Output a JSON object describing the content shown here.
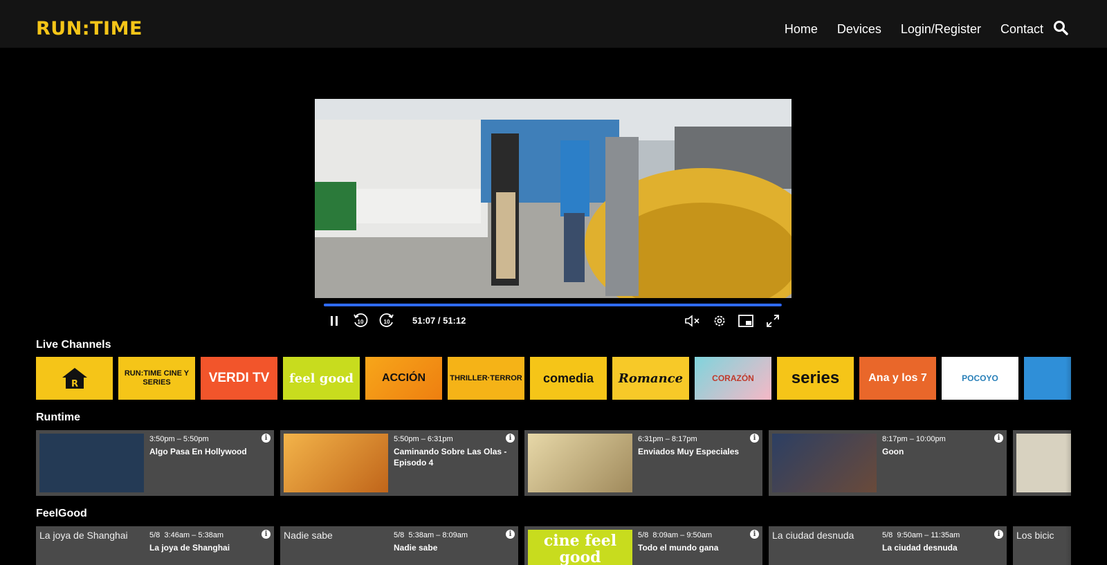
{
  "header": {
    "logo": "RUN:TIME",
    "nav": [
      "Home",
      "Devices",
      "Login/Register",
      "Contact"
    ],
    "search_icon": "search-icon"
  },
  "player": {
    "time": "51:07 / 51:12",
    "progress": 0.998,
    "controls": [
      "pause-icon",
      "rewind-10-icon",
      "forward-10-icon",
      "mute-icon",
      "settings-icon",
      "pip-icon",
      "fullscreen-icon"
    ]
  },
  "live_channels": {
    "title": "Live Channels",
    "items": [
      {
        "name": "home",
        "label": "R",
        "bg": "#f5c518",
        "fg": "#111"
      },
      {
        "name": "runtime-cine-series",
        "label": "RUN:TIME CINE Y SERIES",
        "bg": "#f5c518",
        "fg": "#111"
      },
      {
        "name": "cines-verdi-tv",
        "label": "VERDI TV",
        "bg": "#f2552b",
        "fg": "#fff"
      },
      {
        "name": "feel-good",
        "label": "feel good",
        "bg": "#c8dc1e",
        "fg": "#fff"
      },
      {
        "name": "accion",
        "label": "ACCIÓN",
        "bg": "#f39c12",
        "fg": "#111"
      },
      {
        "name": "thriller-terror",
        "label": "THRILLER·TERROR",
        "bg": "#f5b317",
        "fg": "#111"
      },
      {
        "name": "comedia",
        "label": "comedia",
        "bg": "#f5c518",
        "fg": "#111"
      },
      {
        "name": "romance",
        "label": "Romance",
        "bg": "#f7c928",
        "fg": "#111"
      },
      {
        "name": "corazon",
        "label": "CORAZÓN",
        "bg": "#f6b8c6",
        "fg": "#c0392b"
      },
      {
        "name": "series",
        "label": "series",
        "bg": "#f5c518",
        "fg": "#111"
      },
      {
        "name": "ana-y-los-7",
        "label": "Ana y los 7",
        "bg": "#e9672a",
        "fg": "#fff"
      },
      {
        "name": "pocoyo",
        "label": "POCOYO",
        "bg": "#ffffff",
        "fg": "#2980b9"
      },
      {
        "name": "smurfs",
        "label": "",
        "bg": "#2f8fd8",
        "fg": "#fff"
      }
    ]
  },
  "runtime": {
    "title": "Runtime",
    "items": [
      {
        "time": "3:50pm – 5:50pm",
        "title": "Algo Pasa En Hollywood",
        "thumb_bg": "#243a55"
      },
      {
        "time": "5:50pm – 6:31pm",
        "title": "Caminando Sobre Las Olas - Episodo 4",
        "thumb_bg": "#d88a2a"
      },
      {
        "time": "6:31pm – 8:17pm",
        "title": "Enviados Muy Especiales",
        "thumb_bg": "#c9b78a"
      },
      {
        "time": "8:17pm – 10:00pm",
        "title": "Goon",
        "thumb_bg": "#2c3f63"
      },
      {
        "time": "",
        "title": "",
        "thumb_bg": "#d8d2c0"
      }
    ]
  },
  "feelgood": {
    "title": "FeelGood",
    "items": [
      {
        "date": "5/8",
        "time": "3:46am – 5:38am",
        "title": "La joya de Shanghai",
        "alt": "La joya de Shanghai"
      },
      {
        "date": "5/8",
        "time": "5:38am – 8:09am",
        "title": "Nadie sabe",
        "alt": "Nadie sabe"
      },
      {
        "date": "5/8",
        "time": "8:09am – 9:50am",
        "title": "Todo el mundo gana",
        "alt": ""
      },
      {
        "date": "5/8",
        "time": "9:50am – 11:35am",
        "title": "La ciudad desnuda",
        "alt": "La ciudad desnuda"
      },
      {
        "date": "",
        "time": "",
        "title": "",
        "alt": "Los bicic"
      }
    ],
    "feelgood_thumb_label": "cine feel good"
  },
  "colors": {
    "accent": "#f5c518",
    "progress": "#2f6bff",
    "card_bg": "#4a4a4a",
    "header_bg": "#141414"
  }
}
